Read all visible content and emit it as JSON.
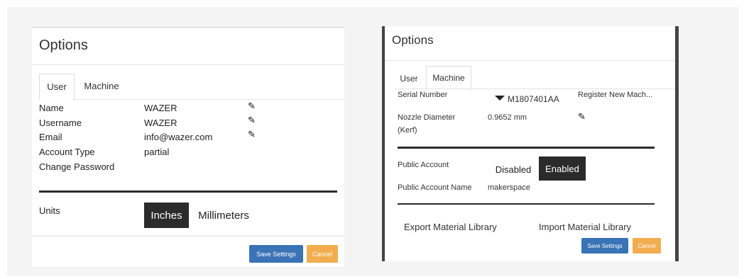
{
  "left": {
    "title": "Options",
    "tabs": [
      "User",
      "Machine"
    ],
    "rows": [
      {
        "label": "Name",
        "value": "WAZER",
        "editable": true
      },
      {
        "label": "Username",
        "value": "WAZER",
        "editable": true
      },
      {
        "label": "Email",
        "value": "info@wazer.com",
        "editable": true
      },
      {
        "label": "Account Type",
        "value": "partial",
        "editable": false
      },
      {
        "label": "Change Password",
        "value": "",
        "editable": false
      }
    ],
    "units_label": "Units",
    "units_options": [
      "Inches",
      "Millimeters"
    ],
    "units_selected": "Inches",
    "save_label": "Save Settings",
    "cancel_label": "Cancel"
  },
  "right": {
    "title": "Options",
    "tabs": [
      "User",
      "Machine"
    ],
    "serial_label": "Serial Number",
    "serial_value": "M1807401AA",
    "register_label": "Register New Mach...",
    "nozzle_label": "Nozzle Diameter",
    "nozzle_label2": "(Kerf)",
    "nozzle_value": "0.9652 mm",
    "public_account_label": "Public Account",
    "public_options": [
      "Disabled",
      "Enabled"
    ],
    "public_selected": "Enabled",
    "public_name_label": "Public Account Name",
    "public_name_value": "makerspace",
    "export_label": "Export Material Library",
    "import_label": "Import Material Library",
    "save_label": "Save Settings",
    "cancel_label": "Cancel"
  },
  "colors": {
    "save": "#3a73b6",
    "cancel": "#f1ad4e",
    "selected": "#2b2b2b"
  }
}
